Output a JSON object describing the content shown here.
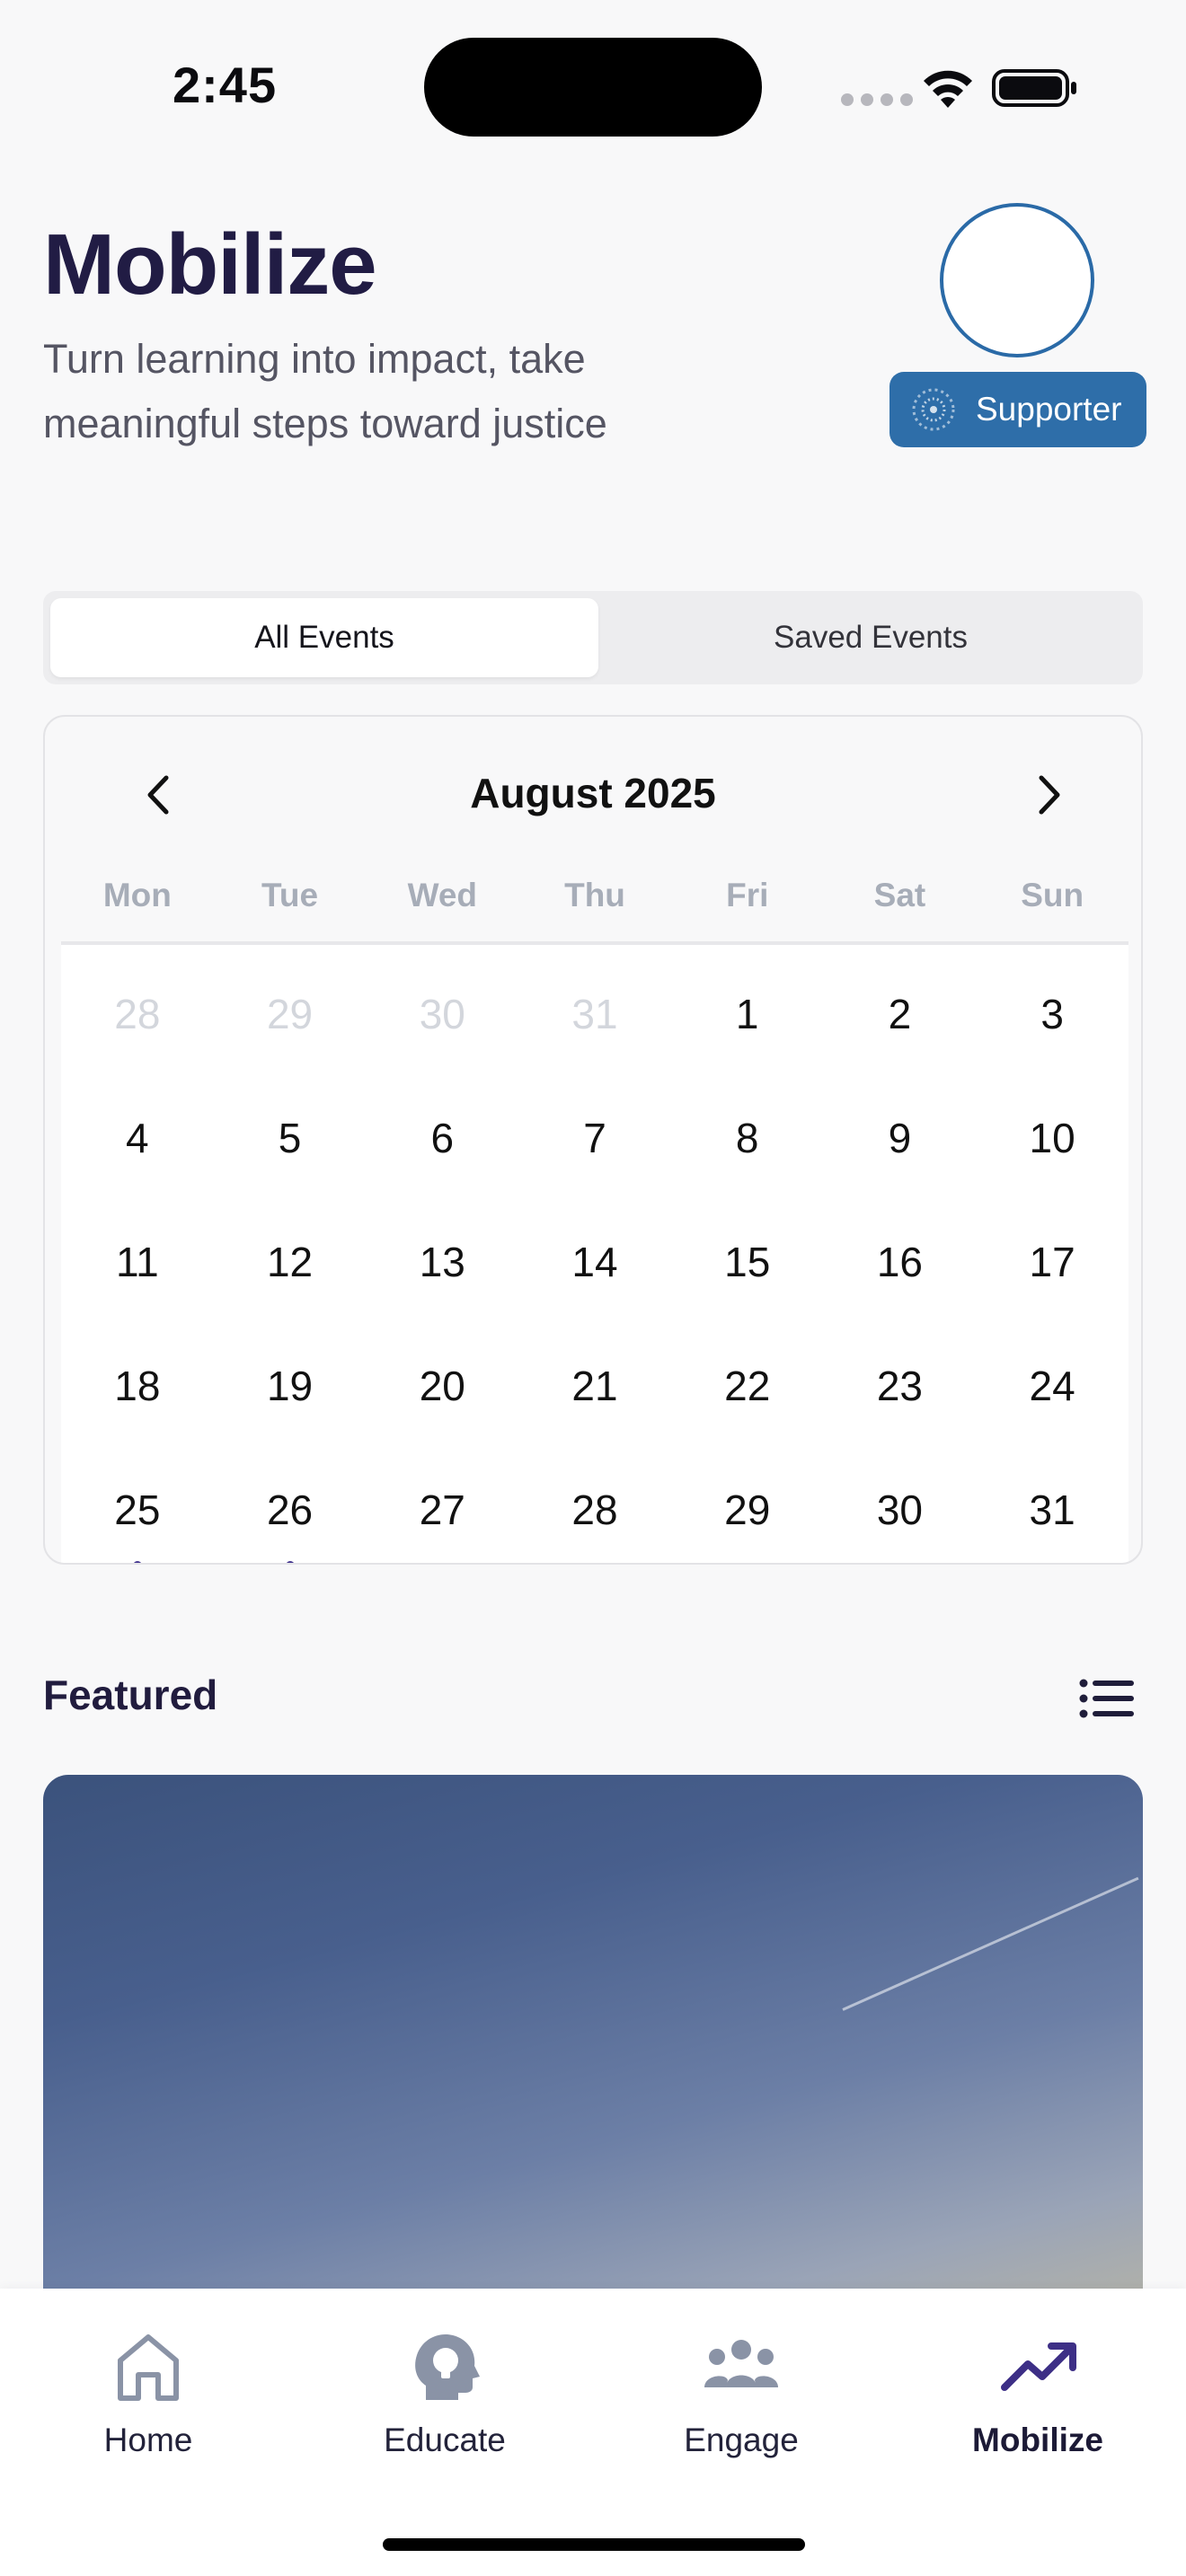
{
  "status_bar": {
    "time": "2:45"
  },
  "header": {
    "title": "Mobilize",
    "subtitle": "Turn learning into impact, take meaningful steps toward justice",
    "badge_label": "Supporter",
    "badge_color": "#2e6ea9"
  },
  "segmented": {
    "options": [
      "All Events",
      "Saved Events"
    ],
    "selected": "All Events"
  },
  "calendar": {
    "month_label": "August 2025",
    "weekdays": [
      "Mon",
      "Tue",
      "Wed",
      "Thu",
      "Fri",
      "Sat",
      "Sun"
    ],
    "days": [
      {
        "d": "28",
        "muted": true
      },
      {
        "d": "29",
        "muted": true
      },
      {
        "d": "30",
        "muted": true
      },
      {
        "d": "31",
        "muted": true
      },
      {
        "d": "1"
      },
      {
        "d": "2"
      },
      {
        "d": "3"
      },
      {
        "d": "4"
      },
      {
        "d": "5"
      },
      {
        "d": "6"
      },
      {
        "d": "7"
      },
      {
        "d": "8"
      },
      {
        "d": "9"
      },
      {
        "d": "10"
      },
      {
        "d": "11"
      },
      {
        "d": "12"
      },
      {
        "d": "13"
      },
      {
        "d": "14"
      },
      {
        "d": "15"
      },
      {
        "d": "16"
      },
      {
        "d": "17"
      },
      {
        "d": "18"
      },
      {
        "d": "19"
      },
      {
        "d": "20"
      },
      {
        "d": "21"
      },
      {
        "d": "22"
      },
      {
        "d": "23"
      },
      {
        "d": "24"
      },
      {
        "d": "25",
        "event": true
      },
      {
        "d": "26",
        "event": true
      },
      {
        "d": "27"
      },
      {
        "d": "28"
      },
      {
        "d": "29"
      },
      {
        "d": "30"
      },
      {
        "d": "31"
      }
    ],
    "event_dot_color": "#43358f"
  },
  "featured": {
    "title": "Featured"
  },
  "tabbar": {
    "tabs": [
      {
        "label": "Home",
        "icon": "home-icon"
      },
      {
        "label": "Educate",
        "icon": "head-lightbulb-icon"
      },
      {
        "label": "Engage",
        "icon": "group-icon"
      },
      {
        "label": "Mobilize",
        "icon": "trending-up-icon"
      }
    ],
    "active": "Mobilize",
    "active_color": "#3d2f86"
  }
}
